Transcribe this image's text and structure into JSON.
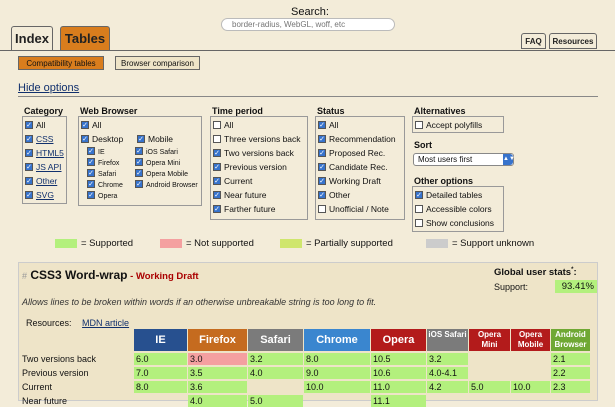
{
  "search": {
    "label": "Search:",
    "placeholder": "border-radius, WebGL, woff, etc"
  },
  "tabs": {
    "index": "Index",
    "tables": "Tables",
    "faq": "FAQ",
    "resources": "Resources"
  },
  "subtabs": {
    "compat": "Compatibility tables",
    "browser": "Browser comparison"
  },
  "hide_options": "Hide options",
  "category": {
    "title": "Category",
    "items": [
      "All",
      "CSS",
      "HTML5",
      "JS API",
      "Other",
      "SVG"
    ]
  },
  "web_browser": {
    "title": "Web Browser",
    "all": "All",
    "desktop": "Desktop",
    "mobile": "Mobile",
    "desktop_items": [
      "IE",
      "Firefox",
      "Safari",
      "Chrome",
      "Opera"
    ],
    "mobile_items": [
      "iOS Safari",
      "Opera Mini",
      "Opera Mobile",
      "Android Browser"
    ]
  },
  "time_period": {
    "title": "Time period",
    "items": [
      "All",
      "Three versions back",
      "Two versions back",
      "Previous version",
      "Current",
      "Near future",
      "Farther future"
    ]
  },
  "status": {
    "title": "Status",
    "items": [
      "All",
      "Recommendation",
      "Proposed Rec.",
      "Candidate Rec.",
      "Working Draft",
      "Other",
      "Unofficial / Note"
    ]
  },
  "alternatives": {
    "title": "Alternatives",
    "items": [
      "Accept polyfills"
    ]
  },
  "sort": {
    "title": "Sort",
    "selected": "Most users first"
  },
  "other_options": {
    "title": "Other options",
    "items": [
      "Detailed tables",
      "Accessible colors",
      "Show conclusions"
    ]
  },
  "legend": {
    "supported": "= Supported",
    "not_supported": "= Not supported",
    "partial": "= Partially supported",
    "unknown": "= Support unknown"
  },
  "colors": {
    "supported": "#b3f07d",
    "not_supported": "#f4a0a0",
    "partial": "#cfe66d",
    "unknown": "#ccc",
    "accent": "#d97d1d"
  },
  "feature": {
    "hash": "#",
    "title": "CSS3 Word-wrap",
    "dash": " - ",
    "status": "Working Draft",
    "description": "Allows lines to be broken within words if an otherwise unbreakable string is too long to fit.",
    "resources_label": "Resources:",
    "resource_link": "MDN article",
    "usage_label": "Global user stats",
    "usage_asterisk": "*",
    "usage_colon": ":",
    "support_label": "Support:",
    "support_value": "93.41%"
  },
  "table": {
    "browsers": [
      {
        "name": "IE",
        "color": "#27508f"
      },
      {
        "name": "Firefox",
        "color": "#c56b1f"
      },
      {
        "name": "Safari",
        "color": "#7b7b7b"
      },
      {
        "name": "Chrome",
        "color": "#3a86cf"
      },
      {
        "name": "Opera",
        "color": "#b31b1b"
      },
      {
        "name": "iOS Safari",
        "color": "#7b7b7b"
      },
      {
        "name": "Opera Mini",
        "color": "#b31b1b"
      },
      {
        "name": "Opera Mobile",
        "color": "#b31b1b"
      },
      {
        "name": "Android Browser",
        "color": "#6fa834"
      }
    ],
    "rows": [
      {
        "label": "Two versions back",
        "cells": [
          "6.0",
          "3.0",
          "3.2",
          "8.0",
          "10.5",
          "3.2",
          "",
          "",
          "2.1"
        ]
      },
      {
        "label": "Previous version",
        "cells": [
          "7.0",
          "3.5",
          "4.0",
          "9.0",
          "10.6",
          "4.0-4.1",
          "",
          "",
          "2.2"
        ]
      },
      {
        "label": "Current",
        "cells": [
          "8.0",
          "3.6",
          "",
          "10.0",
          "11.0",
          "4.2",
          "5.0",
          "10.0",
          "2.3"
        ]
      },
      {
        "label": "Near future",
        "cells": [
          "",
          "4.0",
          "5.0",
          "",
          "11.1",
          "",
          "",
          "",
          ""
        ]
      }
    ]
  }
}
